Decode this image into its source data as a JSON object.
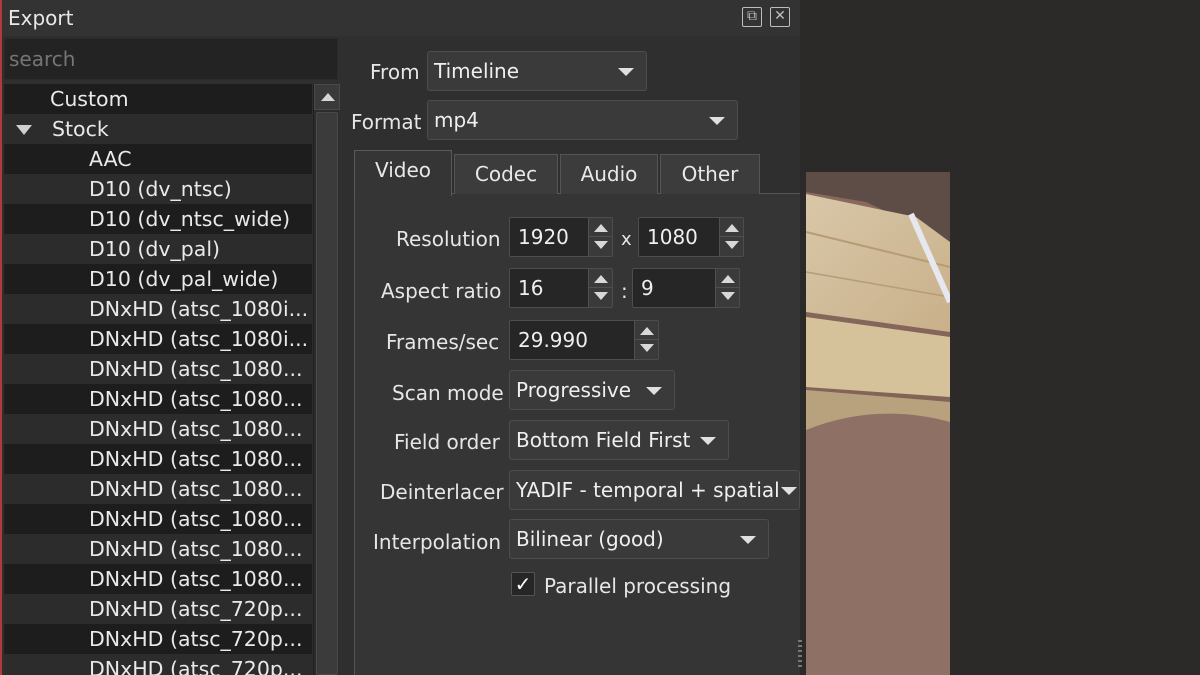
{
  "window": {
    "title": "Export"
  },
  "search": {
    "placeholder": "search"
  },
  "presets": {
    "items": [
      {
        "label": "Custom",
        "level": 0
      },
      {
        "label": "Stock",
        "level": 0,
        "expanded": true
      },
      {
        "label": "AAC",
        "level": 1
      },
      {
        "label": "D10 (dv_ntsc)",
        "level": 1
      },
      {
        "label": "D10 (dv_ntsc_wide)",
        "level": 1
      },
      {
        "label": "D10 (dv_pal)",
        "level": 1
      },
      {
        "label": "D10 (dv_pal_wide)",
        "level": 1
      },
      {
        "label": "DNxHD (atsc_1080i...",
        "level": 1
      },
      {
        "label": "DNxHD (atsc_1080i...",
        "level": 1
      },
      {
        "label": "DNxHD (atsc_1080...",
        "level": 1
      },
      {
        "label": "DNxHD (atsc_1080...",
        "level": 1
      },
      {
        "label": "DNxHD (atsc_1080...",
        "level": 1
      },
      {
        "label": "DNxHD (atsc_1080...",
        "level": 1
      },
      {
        "label": "DNxHD (atsc_1080...",
        "level": 1
      },
      {
        "label": "DNxHD (atsc_1080...",
        "level": 1
      },
      {
        "label": "DNxHD (atsc_1080...",
        "level": 1
      },
      {
        "label": "DNxHD (atsc_1080...",
        "level": 1
      },
      {
        "label": "DNxHD (atsc_720p...",
        "level": 1
      },
      {
        "label": "DNxHD (atsc_720p...",
        "level": 1
      },
      {
        "label": "DNxHD (atsc_720p...",
        "level": 1
      }
    ]
  },
  "from": {
    "label": "From",
    "value": "Timeline"
  },
  "format": {
    "label": "Format",
    "value": "mp4"
  },
  "tabs": [
    {
      "label": "Video",
      "active": true
    },
    {
      "label": "Codec",
      "active": false
    },
    {
      "label": "Audio",
      "active": false
    },
    {
      "label": "Other",
      "active": false
    }
  ],
  "video": {
    "resolution": {
      "label": "Resolution",
      "width": "1920",
      "sep": "x",
      "height": "1080"
    },
    "aspect": {
      "label": "Aspect ratio",
      "num": "16",
      "sep": ":",
      "den": "9"
    },
    "fps": {
      "label": "Frames/sec",
      "value": "29.990"
    },
    "scan_mode": {
      "label": "Scan mode",
      "value": "Progressive"
    },
    "field_order": {
      "label": "Field order",
      "value": "Bottom Field First"
    },
    "deinterlacer": {
      "label": "Deinterlacer",
      "value": "YADIF - temporal + spatial"
    },
    "interpolation": {
      "label": "Interpolation",
      "value": "Bilinear (good)"
    },
    "parallel": {
      "label": "Parallel processing",
      "checked": true,
      "mark": "✓"
    }
  },
  "icons": {
    "float": "float-icon",
    "close": "close-icon"
  }
}
